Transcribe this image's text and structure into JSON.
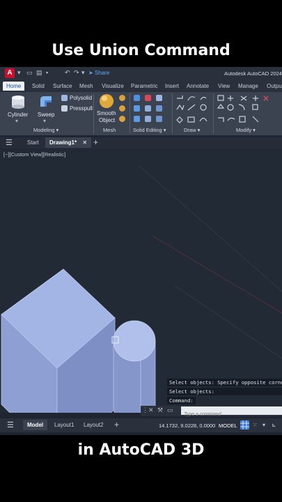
{
  "captions": {
    "top": "Use Union Command",
    "bottom": "in AutoCAD 3D"
  },
  "app": {
    "logo_letter": "A",
    "title": "Autodesk AutoCAD 2024",
    "share_label": "Share",
    "colors": {
      "accent": "#0e4c9a",
      "logo": "#c8102e",
      "bg": "#1f2632",
      "solid": "#9aaee0"
    }
  },
  "ribbon": {
    "tabs": [
      "Home",
      "Solid",
      "Surface",
      "Mesh",
      "Visualize",
      "Parametric",
      "Insert",
      "Annotate",
      "View",
      "Manage",
      "Output"
    ],
    "active_tab": "Home",
    "modeling": {
      "cylinder": "Cylinder",
      "sweep": "Sweep",
      "polysolid": "Polysolid",
      "presspull": "Presspull",
      "title": "Modeling ▾"
    },
    "mesh": {
      "smooth_line1": "Smooth",
      "smooth_line2": "Object",
      "title": "Mesh"
    },
    "solid_editing": {
      "title": "Solid Editing ▾"
    },
    "draw": {
      "title": "Draw ▾"
    },
    "modify": {
      "title": "Modify ▾"
    }
  },
  "file_tabs": {
    "start": "Start",
    "drawing": "Drawing1*",
    "close_glyph": "✕",
    "add_glyph": "+"
  },
  "viewport": {
    "label": "[−][Custom View][Realistic]"
  },
  "command": {
    "history": [
      "Select objects: Specify opposite corner:",
      "Select objects:",
      "Command:"
    ],
    "placeholder": "Type a command"
  },
  "status": {
    "tabs": [
      "Model",
      "Layout1",
      "Layout2"
    ],
    "active": "Model",
    "coords": "14.1732, 9.0228, 0.0000",
    "model_label": "MODEL"
  }
}
